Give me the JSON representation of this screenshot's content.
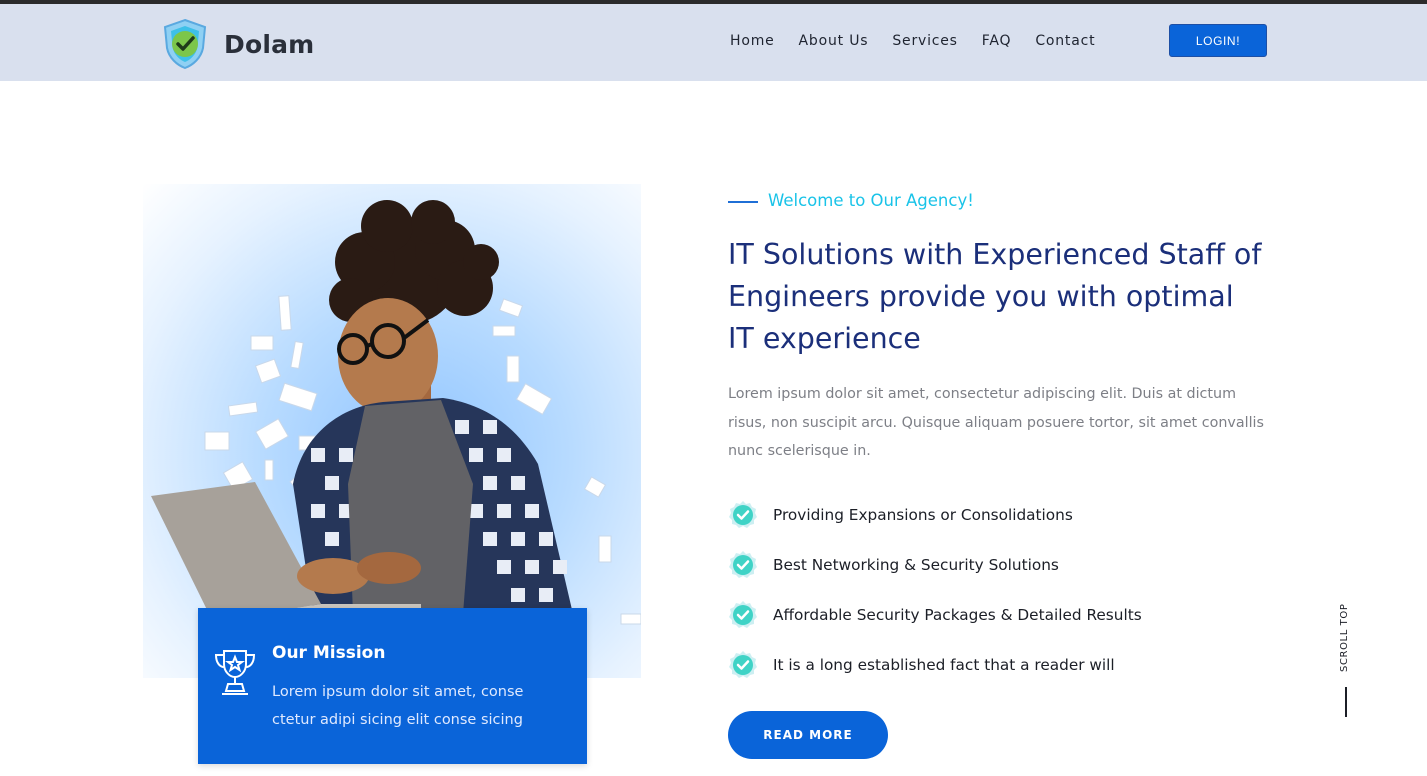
{
  "brand": {
    "name": "Dolam",
    "logo_icon": "shield-check-icon"
  },
  "nav": {
    "items": [
      {
        "label": "Home"
      },
      {
        "label": "About Us"
      },
      {
        "label": "Services"
      },
      {
        "label": "FAQ"
      },
      {
        "label": "Contact"
      }
    ],
    "login_label": "LOGIN!"
  },
  "hero": {
    "photo_alt_icon": "person-with-laptop-photo",
    "mission": {
      "icon": "trophy-star-icon",
      "title": "Our Mission",
      "text": "Lorem ipsum dolor sit amet, conse ctetur adipi sicing elit conse sicing"
    },
    "eyebrow": "Welcome to Our Agency!",
    "headline": "IT Solutions with Experienced Staff of Engineers provide you with optimal IT experience",
    "description": "Lorem ipsum dolor sit amet, consectetur adipiscing elit. Duis at dictum risus, non suscipit arcu. Quisque aliquam posuere tortor, sit amet convallis nunc scelerisque in.",
    "features": [
      {
        "icon": "check-badge-icon",
        "text": "Providing Expansions or Consolidations"
      },
      {
        "icon": "check-badge-icon",
        "text": "Best Networking & Security Solutions"
      },
      {
        "icon": "check-badge-icon",
        "text": "Affordable Security Packages & Detailed Results"
      },
      {
        "icon": "check-badge-icon",
        "text": "It is a long established fact that a reader will"
      }
    ],
    "read_more_label": "READ MORE"
  },
  "scroll_top_label": "SCROLL TOP",
  "colors": {
    "header_bg": "#d9e0ee",
    "primary": "#0a64d9",
    "accent_cyan": "#19c3e8",
    "headline": "#1b2f7a",
    "check_teal": "#3fd3c6"
  }
}
